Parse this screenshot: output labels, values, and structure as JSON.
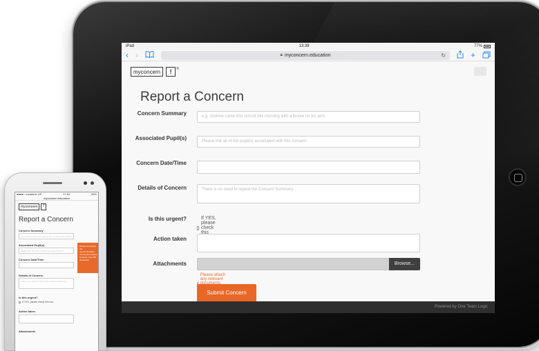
{
  "ipad": {
    "status": {
      "carrier": "iPad",
      "time": "13:39",
      "battery": "77%"
    },
    "url": "myconcern.education",
    "logo": {
      "word": "myconcern",
      "mark": "!",
      "reg": "®"
    },
    "page_title": "Report a Concern",
    "form": {
      "summary": {
        "label": "Concern Summary",
        "placeholder": "e.g. Andrew came into school this morning with a bruise on his arm."
      },
      "pupils": {
        "label": "Associated Pupil(s)",
        "placeholder": "Please link all of the pupil(s) associated with this concern."
      },
      "datetime": {
        "label": "Concern Date/Time",
        "placeholder": ""
      },
      "details": {
        "label": "Details of Concern",
        "placeholder": "There is no need to repeat the Concern Summary."
      },
      "urgent": {
        "label": "Is this urgent?",
        "checkbox_text": "If YES, please check this box."
      },
      "action": {
        "label": "Action taken",
        "placeholder": ""
      },
      "attachments": {
        "label": "Attachments",
        "browse_label": "Browse...",
        "hint": "Please attach any relevant documents, images or other media."
      },
      "submit_label": "Submit Concern"
    },
    "footer": "Powered by One Team Logic"
  },
  "phone": {
    "status": {
      "carrier": "●●●●○ vodafone UK",
      "time": "17:54",
      "battery": "96%"
    },
    "url": "myconcern.education",
    "logo": {
      "word": "myconcern",
      "mark": "!"
    },
    "page_title": "Report a Concern",
    "labels": {
      "summary": "Concern Summary",
      "pupils": "Associated Pupil(s)",
      "datetime": "Concern Date/Time",
      "details": "Details of Concern",
      "urgent": "Is this urgent?",
      "urgent_check": "If YES, please check this box.",
      "action": "Action taken",
      "attachments": "Attachments"
    },
    "placeholders": {
      "summary": "e.g. Andrew came into school this morning with a bruise",
      "pupils": "Please link all of the pupil(s) associated with th",
      "details": "There is no need to repeat the Concern Summary."
    },
    "tooltip": "Briefly summarise the concern/incident naming the pupil(s) involved; max 160 characters."
  },
  "colors": {
    "accent": "#e86726",
    "ios_blue": "#1a82fb",
    "footer_bg": "#2e2e2e"
  },
  "icons": [
    "back-icon",
    "forward-icon",
    "bookmarks-icon",
    "lock-icon",
    "reload-icon",
    "share-icon",
    "new-tab-icon",
    "tabs-icon",
    "info-icon"
  ]
}
